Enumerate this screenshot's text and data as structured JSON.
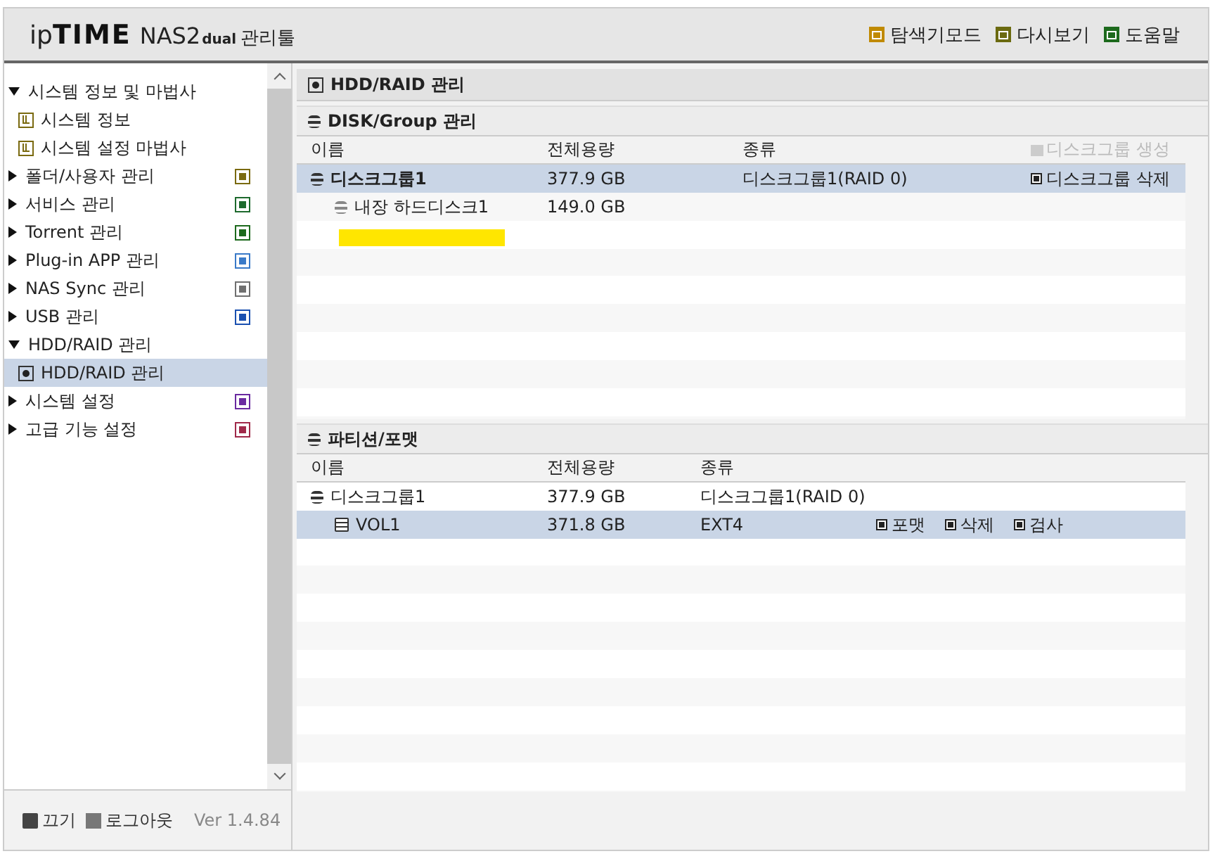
{
  "header": {
    "logo": {
      "brand_a": "ip",
      "brand_b": "TIME",
      "model": "NAS2",
      "suffix": "dual",
      "tool": "관리툴"
    },
    "links": [
      {
        "label": "탐색기모드",
        "color": "#c08a00"
      },
      {
        "label": "다시보기",
        "color": "#6b6a10"
      },
      {
        "label": "도움말",
        "color": "#1d6a1d"
      }
    ]
  },
  "sidebar": {
    "items": [
      {
        "label": "시스템 정보 및 마법사",
        "expanded": true,
        "children": [
          {
            "label": "시스템 정보",
            "selected": false
          },
          {
            "label": "시스템 설정 마법사",
            "selected": false
          }
        ]
      },
      {
        "label": "폴더/사용자 관리",
        "expanded": false,
        "color": "#7a6a10"
      },
      {
        "label": "서비스 관리",
        "expanded": false,
        "color": "#1d6a2d"
      },
      {
        "label": "Torrent 관리",
        "expanded": false,
        "color": "#1d6a1d"
      },
      {
        "label": "Plug-in APP 관리",
        "expanded": false,
        "color": "#3a7ac8"
      },
      {
        "label": "NAS Sync 관리",
        "expanded": false,
        "color": "#707070"
      },
      {
        "label": "USB 관리",
        "expanded": false,
        "color": "#1a50b0"
      },
      {
        "label": "HDD/RAID 관리",
        "expanded": true,
        "children": [
          {
            "label": "HDD/RAID 관리",
            "selected": true
          }
        ]
      },
      {
        "label": "시스템 설정",
        "expanded": false,
        "color": "#6a2aa0"
      },
      {
        "label": "고급 기능 설정",
        "expanded": false,
        "color": "#a02a4a"
      }
    ],
    "footer": {
      "power": "끄기",
      "logout": "로그아웃",
      "version": "Ver 1.4.84"
    }
  },
  "main": {
    "title": "HDD/RAID 관리",
    "sections": [
      {
        "title": "DISK/Group 관리",
        "columns": [
          "이름",
          "전체용량",
          "종류"
        ],
        "action": {
          "label": "디스크그룹 생성",
          "disabled": true
        },
        "rows": [
          {
            "name": "디스크그룹1",
            "capacity": "377.9 GB",
            "type": "디스크그룹1(RAID 0)",
            "selected": true,
            "bold": true,
            "actions": [
              "디스크그룹 삭제"
            ],
            "children": [
              {
                "name": "내장 하드디스크1",
                "capacity": "149.0 GB",
                "selected": false,
                "bold": false,
                "redacted_below": true
              }
            ]
          }
        ]
      },
      {
        "title": "파티션/포맷",
        "columns": [
          "이름",
          "전체용량",
          "종류"
        ],
        "rows": [
          {
            "name": "디스크그룹1",
            "capacity": "377.9 GB",
            "type": "디스크그룹1(RAID 0)",
            "selected": false,
            "bold": false,
            "children": [
              {
                "name": "VOL1",
                "capacity": "371.8 GB",
                "type": "EXT4",
                "selected": true,
                "bold": false,
                "actions": [
                  "포맷",
                  "삭제",
                  "검사"
                ]
              }
            ]
          }
        ]
      }
    ]
  }
}
